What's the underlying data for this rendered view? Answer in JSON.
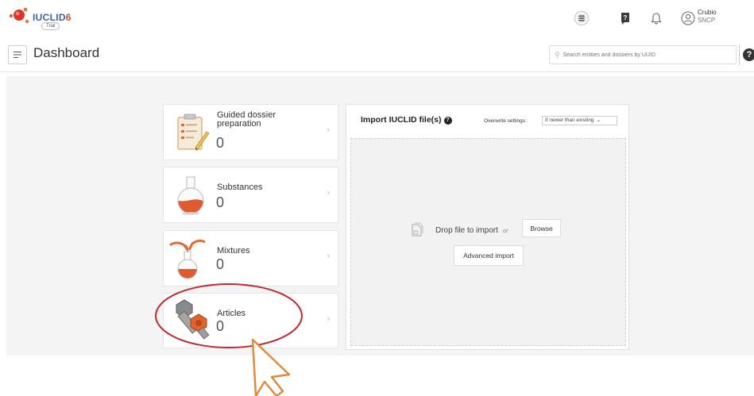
{
  "header": {
    "logo_text": "IUCLID",
    "logo_version": "6",
    "logo_sub": "Trial",
    "user_name": "Crubio",
    "user_org": "SNCP",
    "icons": [
      "tasks-icon",
      "help-book-icon",
      "bell-icon",
      "user-icon"
    ]
  },
  "titlebar": {
    "title": "Dashboard",
    "search_placeholder": "Search entities and dossiers by UUID"
  },
  "tiles": [
    {
      "label": "Guided dossier preparation",
      "count": "0",
      "icon": "clipboard-icon"
    },
    {
      "label": "Substances",
      "count": "0",
      "icon": "flask-icon"
    },
    {
      "label": "Mixtures",
      "count": "0",
      "icon": "mixing-flasks-icon"
    },
    {
      "label": "Articles",
      "count": "0",
      "icon": "bolt-nut-icon"
    }
  ],
  "import": {
    "title": "Import IUCLID file(s)",
    "overwrite_label": "Overwrite settings :",
    "overwrite_value": "If newer than existing",
    "drop_text": "Drop file to import",
    "or_text": "or",
    "browse_label": "Browse",
    "advanced_label": "Advanced import"
  },
  "colors": {
    "annotation_red": "#c0282d",
    "cursor_orange": "#e08a3c"
  }
}
